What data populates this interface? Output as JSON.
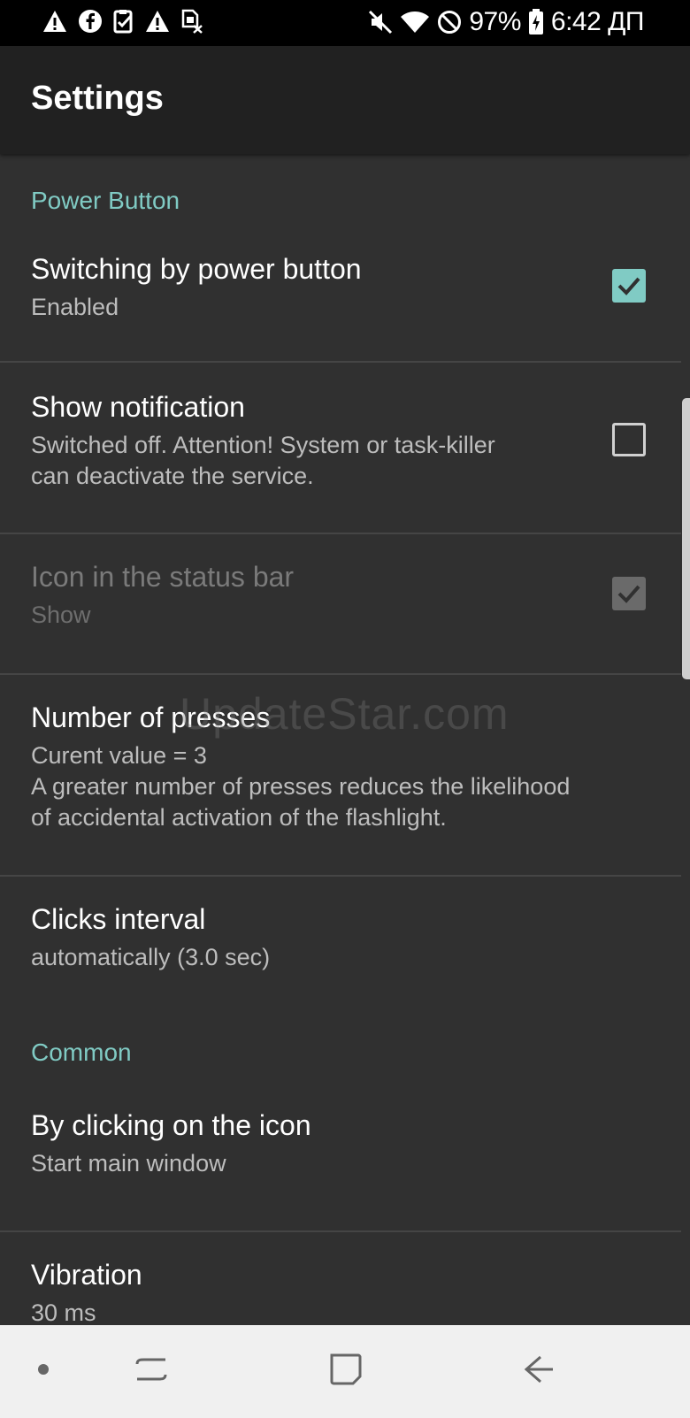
{
  "status_bar": {
    "battery_percent": "97%",
    "time": "6:42 ДП",
    "left_icons": [
      "warning-icon",
      "facebook-icon",
      "clipboard-check-icon",
      "warning-icon",
      "sim-off-icon"
    ],
    "right_icons": [
      "mute-icon",
      "wifi-icon",
      "do-not-disturb-icon",
      "battery-charging-icon"
    ]
  },
  "app_bar": {
    "title": "Settings"
  },
  "sections": {
    "power_button": {
      "header": "Power Button",
      "switching": {
        "title": "Switching by power button",
        "summary": "Enabled",
        "checked": true
      },
      "notification": {
        "title": "Show notification",
        "summary_line1": "Switched off. Attention! System or task-killer",
        "summary_line2": "can deactivate the service.",
        "checked": false
      },
      "status_icon": {
        "title": "Icon in the status bar",
        "summary": "Show",
        "checked": true,
        "enabled": false
      },
      "presses": {
        "title": "Number of presses",
        "summary_line1": "Curent value = 3",
        "summary_line2": "A greater number of presses reduces the likelihood",
        "summary_line3": "of accidental activation of the flashlight."
      },
      "clicks_interval": {
        "title": "Clicks interval",
        "summary": "automatically (3.0 sec)"
      }
    },
    "common": {
      "header": "Common",
      "icon_click": {
        "title": "By clicking on the icon",
        "summary": "Start main window"
      },
      "vibration": {
        "title": "Vibration",
        "summary": "30 ms"
      }
    }
  },
  "watermark": "UpdateStar.com",
  "nav_bar": {
    "buttons": [
      "dot-icon",
      "recents-icon",
      "home-icon",
      "back-icon"
    ]
  },
  "colors": {
    "accent": "#80cbc4",
    "background": "#303030",
    "app_bar": "#212121",
    "status_bar": "#000000",
    "nav_bar": "#f0f0f0"
  }
}
